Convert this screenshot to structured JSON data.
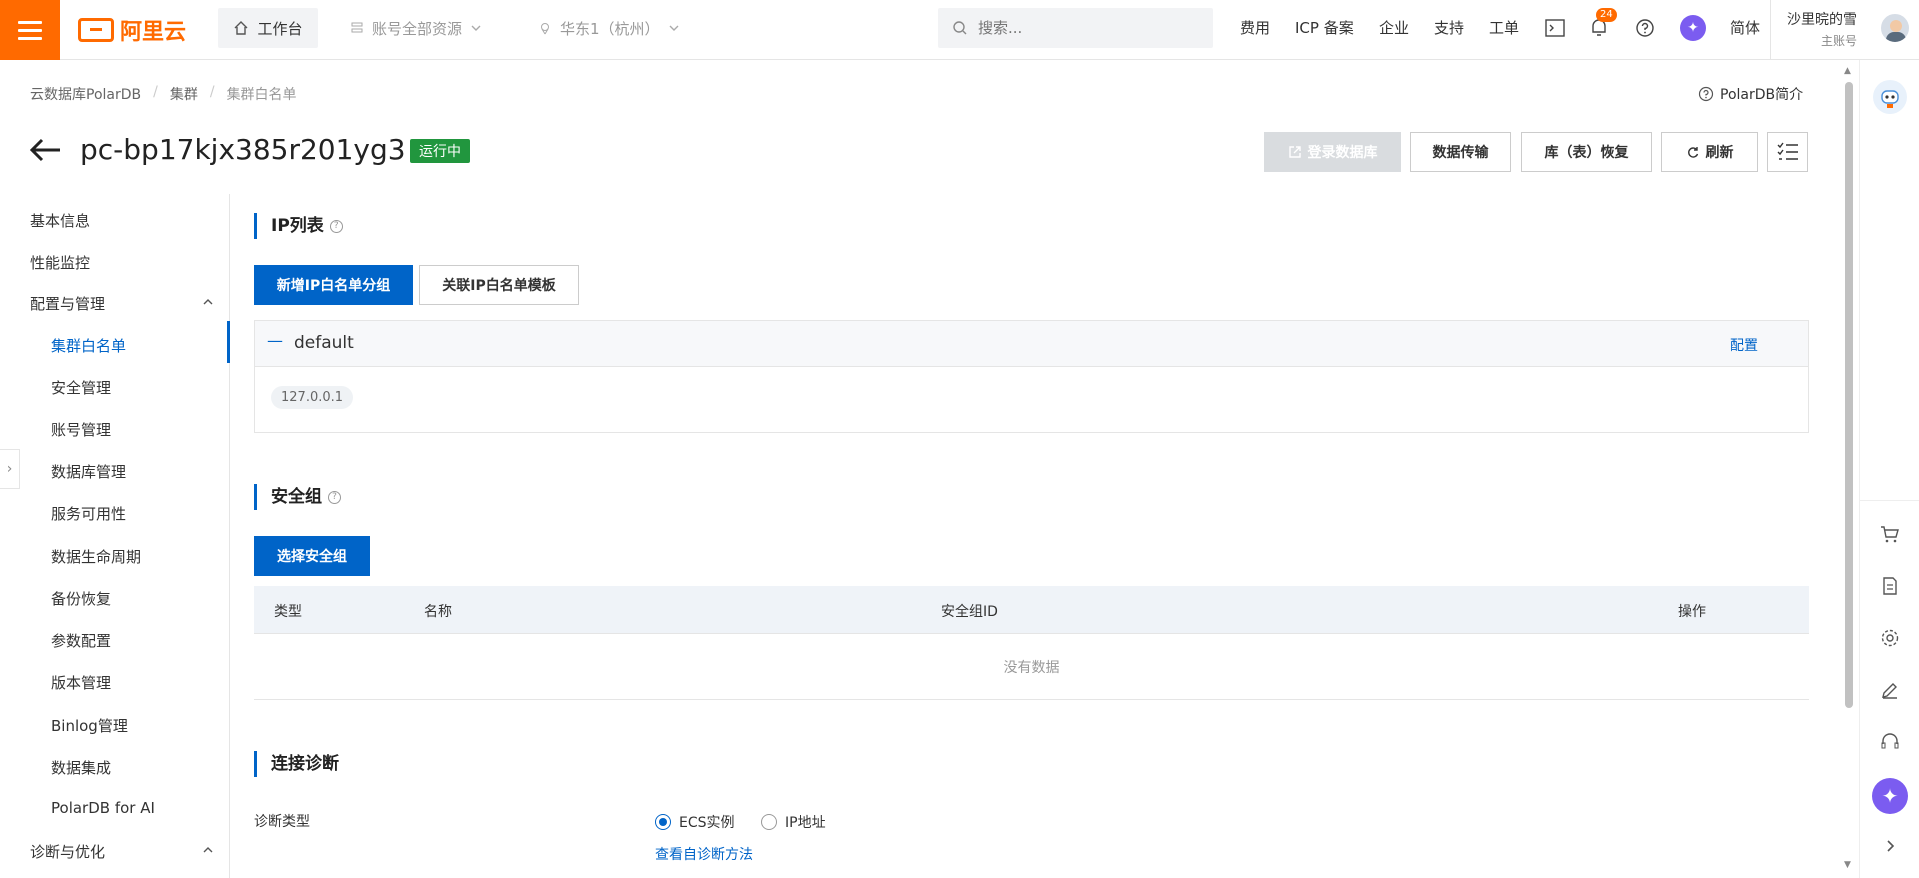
{
  "header": {
    "logo_text": "阿里云",
    "workbench": "工作台",
    "resource_selector": "账号全部资源",
    "region_selector": "华东1（杭州）",
    "search_placeholder": "搜索...",
    "links": [
      "费用",
      "ICP 备案",
      "企业",
      "支持",
      "工单"
    ],
    "notification_count": "24",
    "language": "简体",
    "user_name": "沙里晥的雪",
    "user_role": "主账号"
  },
  "breadcrumb": [
    "云数据库PolarDB",
    "集群",
    "集群白名单"
  ],
  "intro_link": "PolarDB简介",
  "cluster": {
    "id": "pc-bp17kjx385r201yg3",
    "status": "运行中"
  },
  "actions": {
    "login_db": "登录数据库",
    "data_transfer": "数据传输",
    "restore": "库（表）恢复",
    "refresh": "刷新"
  },
  "sidebar": {
    "items": [
      "基本信息",
      "性能监控",
      "配置与管理",
      "集群白名单",
      "安全管理",
      "账号管理",
      "数据库管理",
      "服务可用性",
      "数据生命周期",
      "备份恢复",
      "参数配置",
      "版本管理",
      "Binlog管理",
      "数据集成",
      "PolarDB for AI",
      "诊断与优化"
    ]
  },
  "ip_list": {
    "title": "IP列表",
    "add_group": "新增IP白名单分组",
    "link_template": "关联IP白名单模板",
    "group_name": "default",
    "config": "配置",
    "ip": "127.0.0.1"
  },
  "security_group": {
    "title": "安全组",
    "select": "选择安全组",
    "columns": [
      "类型",
      "名称",
      "安全组ID",
      "操作"
    ],
    "empty": "没有数据"
  },
  "diagnosis": {
    "title": "连接诊断",
    "type_label": "诊断类型",
    "option_ecs": "ECS实例",
    "option_ip": "IP地址",
    "method_link": "查看自诊断方法"
  },
  "colors": {
    "brand": "#ff6a00",
    "primary": "#0064c8",
    "status_green": "#21963e"
  }
}
